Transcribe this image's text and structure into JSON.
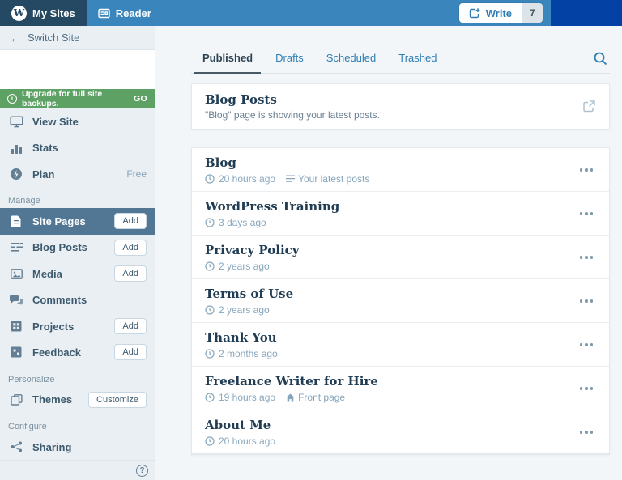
{
  "masterbar": {
    "my_sites_label": "My Sites",
    "reader_label": "Reader",
    "write_label": "Write",
    "notification_count": "7"
  },
  "icons": {
    "back_arrow": "←",
    "wordpress_logo_letter": "W",
    "info": "i",
    "help": "?"
  },
  "sidebar": {
    "switch_site_label": "Switch Site",
    "banner": {
      "text": "Upgrade for full site backups.",
      "action": "GO"
    },
    "top_items": [
      {
        "label": "View Site",
        "icon": "monitor-icon"
      },
      {
        "label": "Stats",
        "icon": "stats-icon"
      },
      {
        "label": "Plan",
        "icon": "plan-icon",
        "badge": "Free"
      }
    ],
    "sections": [
      {
        "label": "Manage"
      },
      {
        "label": "Personalize"
      },
      {
        "label": "Configure"
      }
    ],
    "manage_items": [
      {
        "label": "Site Pages",
        "action": "Add",
        "selected": true
      },
      {
        "label": "Blog Posts",
        "action": "Add"
      },
      {
        "label": "Media",
        "action": "Add"
      },
      {
        "label": "Comments"
      },
      {
        "label": "Projects",
        "action": "Add"
      },
      {
        "label": "Feedback",
        "action": "Add"
      }
    ],
    "personalize_items": [
      {
        "label": "Themes",
        "action": "Customize"
      }
    ],
    "configure_items": [
      {
        "label": "Sharing"
      }
    ]
  },
  "main": {
    "tabs": [
      {
        "label": "Published",
        "active": true
      },
      {
        "label": "Drafts"
      },
      {
        "label": "Scheduled"
      },
      {
        "label": "Trashed"
      }
    ],
    "info_card": {
      "title": "Blog Posts",
      "description": "\"Blog\" page is showing your latest posts."
    },
    "pages": [
      {
        "title": "Blog",
        "time": "20 hours ago",
        "extra": "Your latest posts"
      },
      {
        "title": "WordPress Training",
        "time": "3 days ago"
      },
      {
        "title": "Privacy Policy",
        "time": "2 years ago"
      },
      {
        "title": "Terms of Use",
        "time": "2 years ago"
      },
      {
        "title": "Thank You",
        "time": "2 months ago"
      },
      {
        "title": "Freelance Writer for Hire",
        "time": "19 hours ago",
        "extra": "Front page"
      },
      {
        "title": "About Me",
        "time": "20 hours ago"
      }
    ]
  },
  "colors": {
    "masterbar": "#3a86bc",
    "masterbar_selected": "#254962",
    "redacted_block": "#0341a5",
    "sidebar_bg": "#e9eff3",
    "sidebar_selected": "#527795",
    "banner_green": "#5da264",
    "link_blue": "#2d7db3",
    "title_navy": "#213d54",
    "meta_gray": "#87a6bc"
  }
}
